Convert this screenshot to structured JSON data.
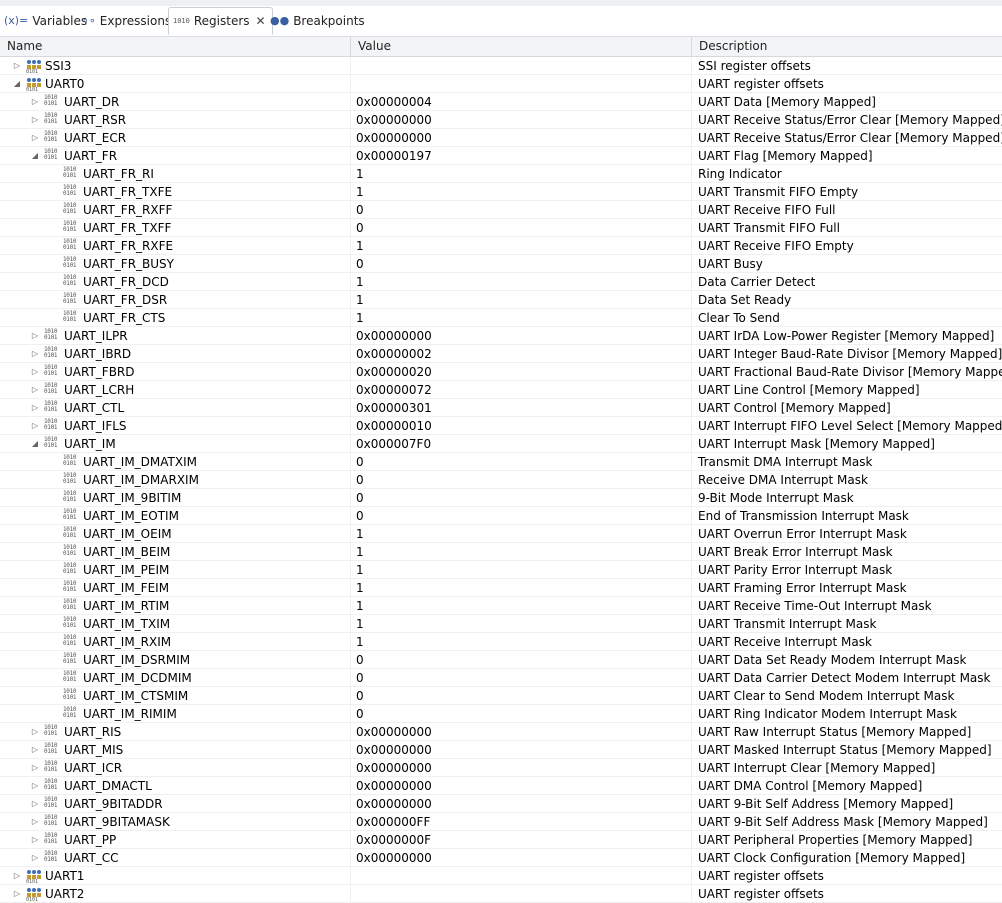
{
  "tabs": [
    {
      "icon": "(x)=",
      "label": "Variables",
      "active": false
    },
    {
      "icon": "∘∘",
      "label": "Expressions",
      "active": false
    },
    {
      "icon": "1010",
      "label": "Registers",
      "active": true,
      "closable": true
    },
    {
      "icon": "●●",
      "label": "Breakpoints",
      "active": false
    }
  ],
  "columns": {
    "name": "Name",
    "value": "Value",
    "description": "Description"
  },
  "rows": [
    {
      "level": 0,
      "kind": "group",
      "exp": "collapsed",
      "name": "SSI3",
      "value": "",
      "desc": "SSI register offsets"
    },
    {
      "level": 0,
      "kind": "group",
      "exp": "expanded",
      "name": "UART0",
      "value": "",
      "desc": "UART register offsets"
    },
    {
      "level": 1,
      "kind": "reg",
      "exp": "collapsed",
      "name": "UART_DR",
      "value": "0x00000004",
      "desc": "UART Data [Memory Mapped]"
    },
    {
      "level": 1,
      "kind": "reg",
      "exp": "collapsed",
      "name": "UART_RSR",
      "value": "0x00000000",
      "desc": "UART Receive Status/Error Clear [Memory Mapped]"
    },
    {
      "level": 1,
      "kind": "reg",
      "exp": "collapsed",
      "name": "UART_ECR",
      "value": "0x00000000",
      "desc": "UART Receive Status/Error Clear [Memory Mapped]"
    },
    {
      "level": 1,
      "kind": "reg",
      "exp": "expanded",
      "name": "UART_FR",
      "value": "0x00000197",
      "desc": "UART Flag [Memory Mapped]"
    },
    {
      "level": 2,
      "kind": "field",
      "exp": "none",
      "name": "UART_FR_RI",
      "value": "1",
      "desc": "Ring Indicator"
    },
    {
      "level": 2,
      "kind": "field",
      "exp": "none",
      "name": "UART_FR_TXFE",
      "value": "1",
      "desc": "UART Transmit FIFO Empty"
    },
    {
      "level": 2,
      "kind": "field",
      "exp": "none",
      "name": "UART_FR_RXFF",
      "value": "0",
      "desc": "UART Receive FIFO Full"
    },
    {
      "level": 2,
      "kind": "field",
      "exp": "none",
      "name": "UART_FR_TXFF",
      "value": "0",
      "desc": "UART Transmit FIFO Full"
    },
    {
      "level": 2,
      "kind": "field",
      "exp": "none",
      "name": "UART_FR_RXFE",
      "value": "1",
      "desc": "UART Receive FIFO Empty"
    },
    {
      "level": 2,
      "kind": "field",
      "exp": "none",
      "name": "UART_FR_BUSY",
      "value": "0",
      "desc": "UART Busy"
    },
    {
      "level": 2,
      "kind": "field",
      "exp": "none",
      "name": "UART_FR_DCD",
      "value": "1",
      "desc": "Data Carrier Detect"
    },
    {
      "level": 2,
      "kind": "field",
      "exp": "none",
      "name": "UART_FR_DSR",
      "value": "1",
      "desc": "Data Set Ready"
    },
    {
      "level": 2,
      "kind": "field",
      "exp": "none",
      "name": "UART_FR_CTS",
      "value": "1",
      "desc": "Clear To Send"
    },
    {
      "level": 1,
      "kind": "reg",
      "exp": "collapsed",
      "name": "UART_ILPR",
      "value": "0x00000000",
      "desc": "UART IrDA Low-Power Register [Memory Mapped]"
    },
    {
      "level": 1,
      "kind": "reg",
      "exp": "collapsed",
      "name": "UART_IBRD",
      "value": "0x00000002",
      "desc": "UART Integer Baud-Rate Divisor [Memory Mapped]"
    },
    {
      "level": 1,
      "kind": "reg",
      "exp": "collapsed",
      "name": "UART_FBRD",
      "value": "0x00000020",
      "desc": "UART Fractional Baud-Rate Divisor [Memory Mapped]"
    },
    {
      "level": 1,
      "kind": "reg",
      "exp": "collapsed",
      "name": "UART_LCRH",
      "value": "0x00000072",
      "desc": "UART Line Control [Memory Mapped]"
    },
    {
      "level": 1,
      "kind": "reg",
      "exp": "collapsed",
      "name": "UART_CTL",
      "value": "0x00000301",
      "desc": "UART Control [Memory Mapped]"
    },
    {
      "level": 1,
      "kind": "reg",
      "exp": "collapsed",
      "name": "UART_IFLS",
      "value": "0x00000010",
      "desc": "UART Interrupt FIFO Level Select [Memory Mapped]"
    },
    {
      "level": 1,
      "kind": "reg",
      "exp": "expanded",
      "name": "UART_IM",
      "value": "0x000007F0",
      "desc": "UART Interrupt Mask [Memory Mapped]"
    },
    {
      "level": 2,
      "kind": "field",
      "exp": "none",
      "name": "UART_IM_DMATXIM",
      "value": "0",
      "desc": "Transmit DMA Interrupt Mask"
    },
    {
      "level": 2,
      "kind": "field",
      "exp": "none",
      "name": "UART_IM_DMARXIM",
      "value": "0",
      "desc": "Receive DMA Interrupt Mask"
    },
    {
      "level": 2,
      "kind": "field",
      "exp": "none",
      "name": "UART_IM_9BITIM",
      "value": "0",
      "desc": "9-Bit Mode Interrupt Mask"
    },
    {
      "level": 2,
      "kind": "field",
      "exp": "none",
      "name": "UART_IM_EOTIM",
      "value": "0",
      "desc": "End of Transmission Interrupt Mask"
    },
    {
      "level": 2,
      "kind": "field",
      "exp": "none",
      "name": "UART_IM_OEIM",
      "value": "1",
      "desc": "UART Overrun Error Interrupt Mask"
    },
    {
      "level": 2,
      "kind": "field",
      "exp": "none",
      "name": "UART_IM_BEIM",
      "value": "1",
      "desc": "UART Break Error Interrupt Mask"
    },
    {
      "level": 2,
      "kind": "field",
      "exp": "none",
      "name": "UART_IM_PEIM",
      "value": "1",
      "desc": "UART Parity Error Interrupt Mask"
    },
    {
      "level": 2,
      "kind": "field",
      "exp": "none",
      "name": "UART_IM_FEIM",
      "value": "1",
      "desc": "UART Framing Error Interrupt Mask"
    },
    {
      "level": 2,
      "kind": "field",
      "exp": "none",
      "name": "UART_IM_RTIM",
      "value": "1",
      "desc": "UART Receive Time-Out Interrupt Mask"
    },
    {
      "level": 2,
      "kind": "field",
      "exp": "none",
      "name": "UART_IM_TXIM",
      "value": "1",
      "desc": "UART Transmit Interrupt Mask"
    },
    {
      "level": 2,
      "kind": "field",
      "exp": "none",
      "name": "UART_IM_RXIM",
      "value": "1",
      "desc": "UART Receive Interrupt Mask"
    },
    {
      "level": 2,
      "kind": "field",
      "exp": "none",
      "name": "UART_IM_DSRMIM",
      "value": "0",
      "desc": "UART Data Set Ready Modem Interrupt Mask"
    },
    {
      "level": 2,
      "kind": "field",
      "exp": "none",
      "name": "UART_IM_DCDMIM",
      "value": "0",
      "desc": "UART Data Carrier Detect Modem Interrupt Mask"
    },
    {
      "level": 2,
      "kind": "field",
      "exp": "none",
      "name": "UART_IM_CTSMIM",
      "value": "0",
      "desc": "UART Clear to Send Modem Interrupt Mask"
    },
    {
      "level": 2,
      "kind": "field",
      "exp": "none",
      "name": "UART_IM_RIMIM",
      "value": "0",
      "desc": "UART Ring Indicator Modem Interrupt Mask"
    },
    {
      "level": 1,
      "kind": "reg",
      "exp": "collapsed",
      "name": "UART_RIS",
      "value": "0x00000000",
      "desc": "UART Raw Interrupt Status [Memory Mapped]"
    },
    {
      "level": 1,
      "kind": "reg",
      "exp": "collapsed",
      "name": "UART_MIS",
      "value": "0x00000000",
      "desc": "UART Masked Interrupt Status [Memory Mapped]"
    },
    {
      "level": 1,
      "kind": "reg",
      "exp": "collapsed",
      "name": "UART_ICR",
      "value": "0x00000000",
      "desc": "UART Interrupt Clear [Memory Mapped]"
    },
    {
      "level": 1,
      "kind": "reg",
      "exp": "collapsed",
      "name": "UART_DMACTL",
      "value": "0x00000000",
      "desc": "UART DMA Control [Memory Mapped]"
    },
    {
      "level": 1,
      "kind": "reg",
      "exp": "collapsed",
      "name": "UART_9BITADDR",
      "value": "0x00000000",
      "desc": "UART 9-Bit Self Address [Memory Mapped]"
    },
    {
      "level": 1,
      "kind": "reg",
      "exp": "collapsed",
      "name": "UART_9BITAMASK",
      "value": "0x000000FF",
      "desc": "UART 9-Bit Self Address Mask [Memory Mapped]"
    },
    {
      "level": 1,
      "kind": "reg",
      "exp": "collapsed",
      "name": "UART_PP",
      "value": "0x0000000F",
      "desc": "UART Peripheral Properties [Memory Mapped]"
    },
    {
      "level": 1,
      "kind": "reg",
      "exp": "collapsed",
      "name": "UART_CC",
      "value": "0x00000000",
      "desc": "UART Clock Configuration [Memory Mapped]"
    },
    {
      "level": 0,
      "kind": "group",
      "exp": "collapsed",
      "name": "UART1",
      "value": "",
      "desc": "UART register offsets"
    },
    {
      "level": 0,
      "kind": "group",
      "exp": "collapsed",
      "name": "UART2",
      "value": "",
      "desc": "UART register offsets"
    }
  ]
}
